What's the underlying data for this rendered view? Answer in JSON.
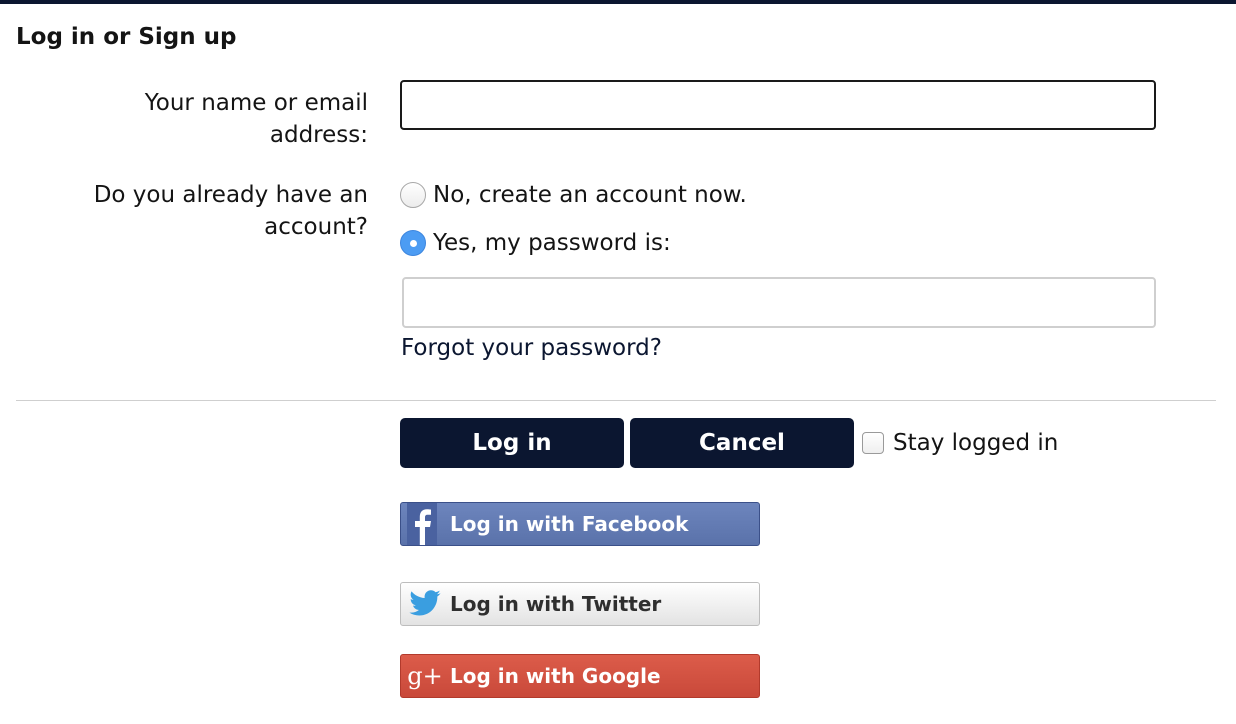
{
  "title": "Log in or Sign up",
  "form": {
    "name_label": "Your name or email address:",
    "name_value": "",
    "account_label": "Do you already have an account?",
    "radio_no_label": "No, create an account now.",
    "radio_yes_label": "Yes, my password is:",
    "password_value": "",
    "forgot_link": "Forgot your password?",
    "login_button": "Log in",
    "cancel_button": "Cancel",
    "stay_logged_in_label": "Stay logged in"
  },
  "social": {
    "facebook": "Log in with Facebook",
    "twitter": "Log in with Twitter",
    "google": "Log in with Google"
  },
  "colors": {
    "primary": "#0b1630",
    "facebook": "#5f77af",
    "google": "#d2503f",
    "radio_selected": "#4c9cf3"
  },
  "icons": [
    "facebook-icon",
    "twitter-icon",
    "google-plus-icon"
  ]
}
